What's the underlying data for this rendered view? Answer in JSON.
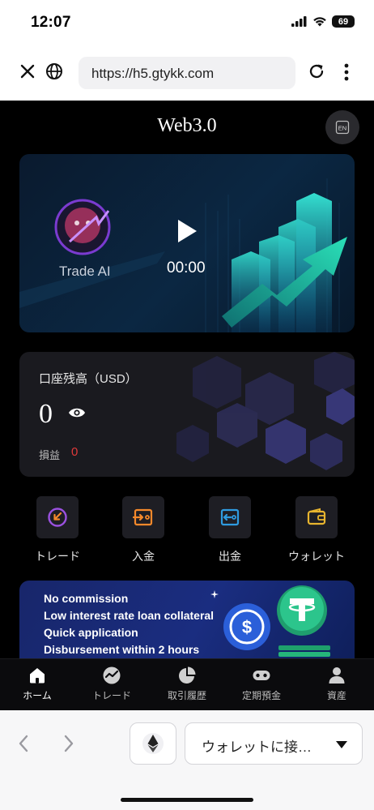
{
  "status_bar": {
    "time": "12:07",
    "battery": "69",
    "icons": [
      "signal-icon",
      "wifi-icon",
      "battery-icon"
    ]
  },
  "browser": {
    "url": "https://h5.gtykk.com",
    "icons": [
      "close-icon",
      "globe-icon",
      "reload-icon",
      "more-icon"
    ]
  },
  "app": {
    "title": "Web3.0",
    "lang_button": "EN",
    "video": {
      "brand": "Trade AI",
      "time": "00:00"
    },
    "balance": {
      "label": "口座残高（USD）",
      "value": "0",
      "pl_label": "損益",
      "pl_value": "0"
    },
    "actions": [
      {
        "label": "トレード",
        "icon": "trade-icon",
        "color": "#9b51e0"
      },
      {
        "label": "入金",
        "icon": "deposit-icon",
        "color": "#f5892b"
      },
      {
        "label": "出金",
        "icon": "withdraw-icon",
        "color": "#2f9be0"
      },
      {
        "label": "ウォレット",
        "icon": "wallet-icon",
        "color": "#e8b52f"
      }
    ],
    "promo": {
      "lines": [
        "No commission",
        "Low interest rate loan collateral",
        "Quick application",
        "Disbursement within 2 hours"
      ]
    },
    "tabs": [
      {
        "label": "ホーム",
        "icon": "home-icon",
        "active": true
      },
      {
        "label": "トレード",
        "icon": "trade-chart-icon",
        "active": false
      },
      {
        "label": "取引履歴",
        "icon": "pie-chart-icon",
        "active": false
      },
      {
        "label": "定期預金",
        "icon": "deposit-box-icon",
        "active": false
      },
      {
        "label": "資産",
        "icon": "user-icon",
        "active": false
      }
    ]
  },
  "bottom_toolbar": {
    "wallet_button": "ウォレットに接…",
    "icons": [
      "back-icon",
      "forward-icon",
      "ethereum-icon",
      "caret-down-icon"
    ]
  },
  "colors": {
    "accent_loss": "#e03a3a",
    "app_background": "#000000",
    "card_background": "#1a1a1f"
  }
}
